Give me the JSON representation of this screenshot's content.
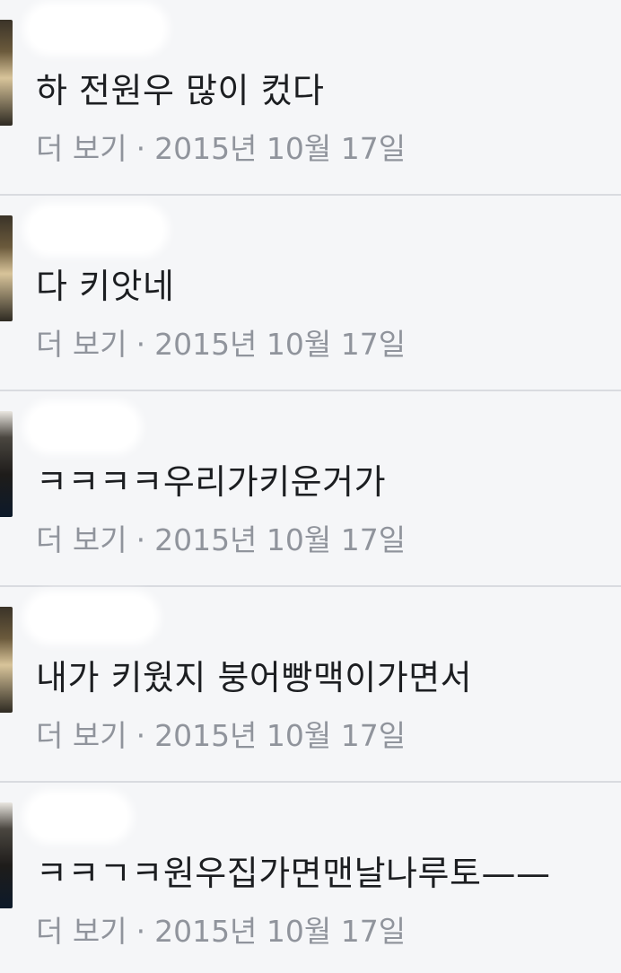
{
  "comments": [
    {
      "text": "하 전원우 많이 컸다",
      "more_label": "더 보기",
      "separator": "·",
      "date": "2015년 10월 17일"
    },
    {
      "text": "다 키앗네",
      "more_label": "더 보기",
      "separator": "·",
      "date": "2015년 10월 17일"
    },
    {
      "text": "ㅋㅋㅋㅋ우리가키운거가",
      "more_label": "더 보기",
      "separator": "·",
      "date": "2015년 10월 17일"
    },
    {
      "text": "내가 키웠지 붕어빵맥이가면서",
      "more_label": "더 보기",
      "separator": "·",
      "date": "2015년 10월 17일"
    },
    {
      "text": "ㅋㅋㄱㅋ원우집가면맨날나루토——",
      "more_label": "더 보기",
      "separator": "·",
      "date": "2015년 10월 17일"
    }
  ]
}
